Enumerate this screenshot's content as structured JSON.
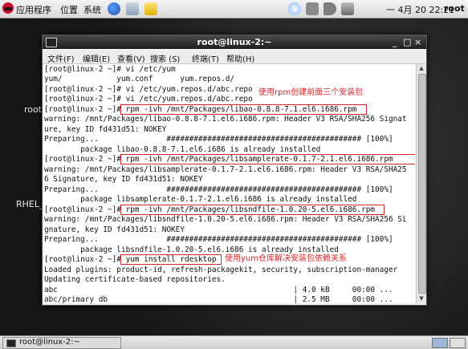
{
  "top_panel": {
    "menus": [
      "应用程序",
      "位置",
      "系统"
    ],
    "clock": "一 4月 20 22:21",
    "user": "root"
  },
  "desktop": {
    "icon_labels": [
      "root",
      "RHEL_"
    ]
  },
  "window": {
    "title": "root@linux-2:~",
    "controls": {
      "minimize": "_",
      "maximize": "□",
      "close": "×"
    },
    "menu": [
      "文件(F)",
      "编辑(E)",
      "查看(V)",
      "搜索 (S)",
      "终端(T)",
      "帮助(H)"
    ]
  },
  "terminal": {
    "lines": [
      "[root@linux-2 ~]# vi /etc/yum",
      "yum/            yum.conf      yum.repos.d/",
      "[root@linux-2 ~]# vi /etc/yum.repos.d/abc.repo",
      "[root@linux-2 ~]# vi /etc/yum.repos.d/abc.repo",
      "[root@linux-2 ~]# rpm -ivh /mnt/Packages/libao-0.8.8-7.1.el6.i686.rpm",
      "warning: /mnt/Packages/libao-0.8.8-7.1.el6.i686.rpm: Header V3 RSA/SHA256 Signat",
      "ure, key ID fd431d51: NOKEY",
      "Preparing...               ########################################### [100%]",
      "        package libao-0.8.8-7.1.el6.i686 is already installed",
      "[root@linux-2 ~]# rpm -ivh /mnt/Packages/libsamplerate-0.1.7-2.1.el6.i686.rpm",
      "warning: /mnt/Packages/libsamplerate-0.1.7-2.1.el6.i686.rpm: Header V3 RSA/SHA25",
      "6 Signature, key ID fd431d51: NOKEY",
      "Preparing...               ########################################### [100%]",
      "        package libsamplerate-0.1.7-2.1.el6.i686 is already installed",
      "[root@linux-2 ~]# rpm -ivh /mnt/Packages/libsndfile-1.0.20-5.el6.i686.rpm",
      "warning: /mnt/Packages/libsndfile-1.0.20-5.el6.i686.rpm: Header V3 RSA/SHA256 Si",
      "gnature, key ID fd431d51: NOKEY",
      "Preparing...               ########################################### [100%]",
      "        package libsndfile-1.0.20-5.el6.i686 is already installed",
      "[root@linux-2 ~]# yum install rdesktop",
      "Loaded plugins: product-id, refresh-packagekit, security, subscription-manager",
      "Updating certificate-based repositories.",
      "abc                                                    | 4.0 kB     00:00 ...",
      "abc/primary_db                                         | 2.5 MB     00:00 ..."
    ],
    "annotations": [
      "使用rpm创建前面三个安装包",
      "使用yum仓库解决安装包依赖关系"
    ]
  },
  "scrollbar": {
    "up": "▲",
    "down": "▼"
  },
  "taskbar": {
    "task": "root@linux-2:~"
  },
  "colors": {
    "annotation": "#d6262b",
    "terminal_bg": "#ffffff",
    "titlebar": "#2a2a2a"
  }
}
